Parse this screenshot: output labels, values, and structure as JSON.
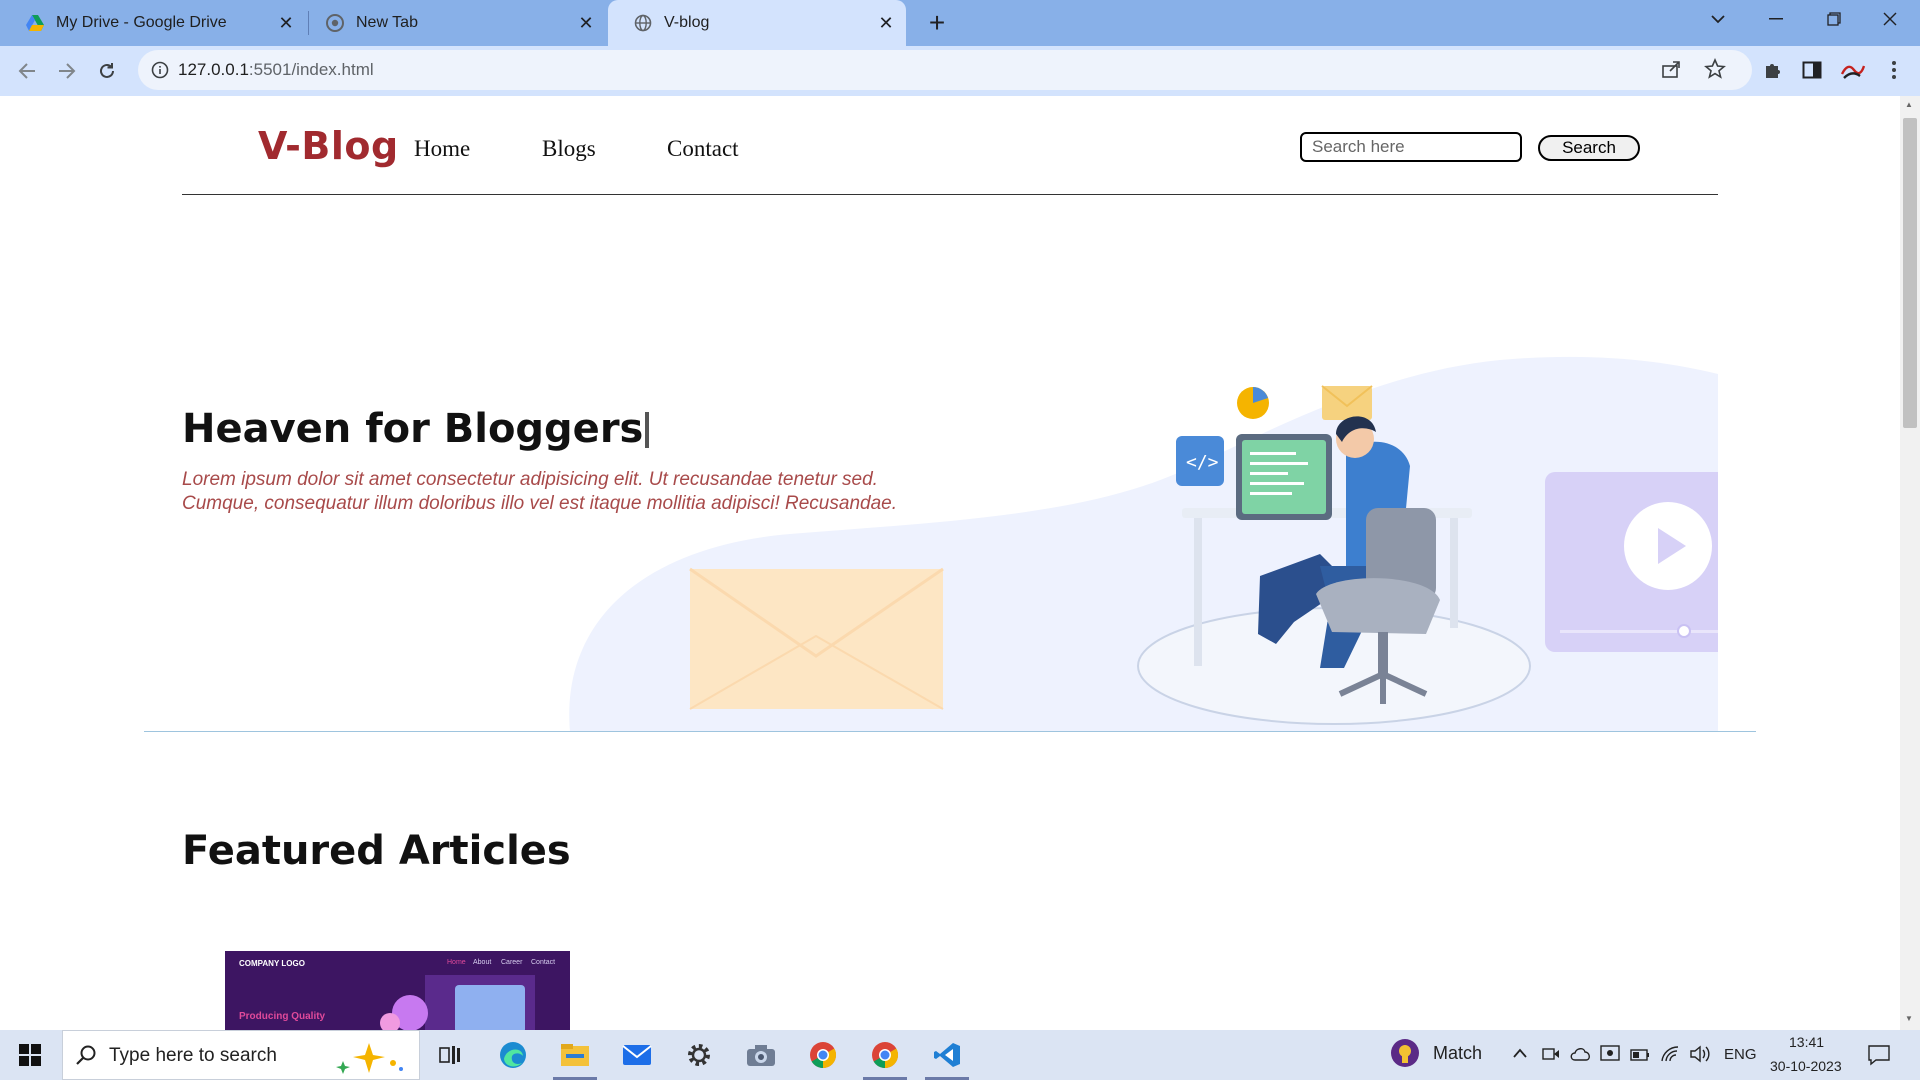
{
  "browser": {
    "tabs": [
      {
        "title": "My Drive - Google Drive",
        "icon": "google-drive-icon",
        "active": false
      },
      {
        "title": "New Tab",
        "icon": "chrome-icon",
        "active": false
      },
      {
        "title": "V-blog",
        "icon": "globe-icon",
        "active": true
      }
    ],
    "url_host": "127.0.0.1",
    "url_rest": ":5501/index.html"
  },
  "site": {
    "logo": "V-Blog",
    "nav": [
      "Home",
      "Blogs",
      "Contact"
    ],
    "search_placeholder": "Search here",
    "search_button": "Search"
  },
  "hero": {
    "title": "Heaven for Bloggers",
    "text": "Lorem ipsum dolor sit amet consectetur adipisicing elit. Ut recusandae tenetur sed. Cumque, consequatur illum doloribus illo vel est itaque mollitia adipisci! Recusandae."
  },
  "featured": {
    "title": "Featured Articles",
    "card": {
      "company": "COMPANY LOGO",
      "nav": [
        "Home",
        "About",
        "Career",
        "Contact"
      ],
      "headline": "Producing Quality"
    }
  },
  "taskbar": {
    "search_text": "Type here to search",
    "weather": "Match",
    "lang": "ENG",
    "time": "13:41",
    "date": "30-10-2023"
  },
  "colors": {
    "tabstrip": "#88b0e8",
    "toolbar": "#d3e3fd",
    "logo": "#a12a2f",
    "hero_text": "#a84a4a",
    "taskbar": "#dbe4f3"
  }
}
